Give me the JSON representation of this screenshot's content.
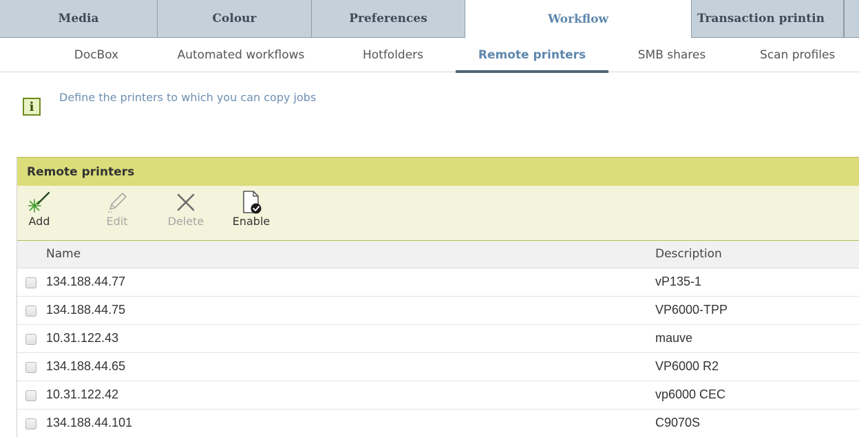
{
  "top_tabs": [
    {
      "label": "Media",
      "active": false
    },
    {
      "label": "Colour",
      "active": false
    },
    {
      "label": "Preferences",
      "active": false
    },
    {
      "label": "Workflow",
      "active": true
    },
    {
      "label": "Transaction printin",
      "active": false
    }
  ],
  "sub_tabs": [
    {
      "label": "DocBox",
      "active": false
    },
    {
      "label": "Automated workflows",
      "active": false
    },
    {
      "label": "Hotfolders",
      "active": false
    },
    {
      "label": "Remote printers",
      "active": true
    },
    {
      "label": "SMB shares",
      "active": false
    },
    {
      "label": "Scan profiles",
      "active": false
    }
  ],
  "info": {
    "icon": "info-icon",
    "glyph": "i",
    "text": "Define the printers to which you can copy jobs"
  },
  "panel": {
    "title": "Remote printers",
    "toolbar": [
      {
        "label": "Add",
        "icon": "add-icon",
        "enabled": true
      },
      {
        "label": "Edit",
        "icon": "pencil-icon",
        "enabled": false
      },
      {
        "label": "Delete",
        "icon": "delete-x-icon",
        "enabled": false
      },
      {
        "label": "Enable",
        "icon": "enable-document-icon",
        "enabled": true
      }
    ],
    "columns": {
      "name": "Name",
      "description": "Description"
    },
    "rows": [
      {
        "name": "134.188.44.77",
        "description": "vP135-1"
      },
      {
        "name": "134.188.44.75",
        "description": "VP6000-TPP"
      },
      {
        "name": "10.31.122.43",
        "description": "mauve"
      },
      {
        "name": "134.188.44.65",
        "description": "VP6000 R2"
      },
      {
        "name": "10.31.122.42",
        "description": "vp6000 CEC"
      },
      {
        "name": "134.188.44.101",
        "description": "C9070S"
      }
    ]
  },
  "colors": {
    "tab_background": "#c4d1db",
    "active_accent": "#5e87ad",
    "panel_header": "#dbdd7a",
    "toolbar_background": "#f3f4db",
    "info_icon_border": "#6c8a1d"
  }
}
